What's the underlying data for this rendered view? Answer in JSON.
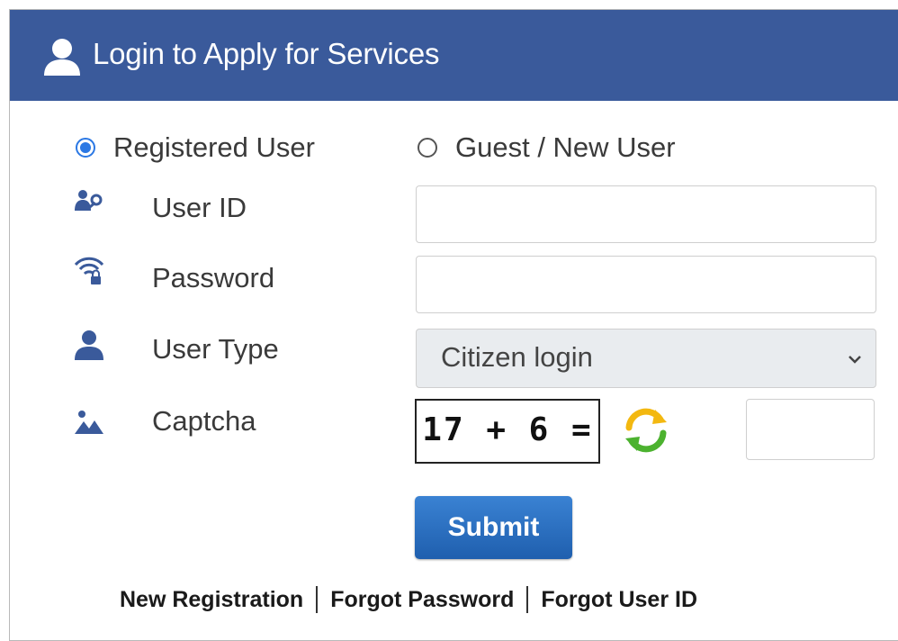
{
  "header": {
    "title": "Login to Apply for Services",
    "icon": "user-icon",
    "background": "#3a5a9b"
  },
  "user_kind": {
    "options": [
      {
        "label": "Registered User",
        "selected": true
      },
      {
        "label": "Guest / New User",
        "selected": false
      }
    ]
  },
  "fields": {
    "user_id": {
      "label": "User ID",
      "icon": "user-key-icon",
      "value": ""
    },
    "password": {
      "label": "Password",
      "icon": "wifi-lock-icon",
      "value": ""
    },
    "user_type": {
      "label": "User Type",
      "icon": "person-icon",
      "selected": "Citizen login"
    },
    "captcha": {
      "label": "Captcha",
      "icon": "image-icon",
      "challenge": "17 + 6 =",
      "answer": ""
    }
  },
  "submit_label": "Submit",
  "footer_links": [
    "New Registration",
    "Forgot Password",
    "Forgot User ID"
  ],
  "colors": {
    "accent": "#2b78e4",
    "button": "#2668bd",
    "icon": "#3a5a9b"
  }
}
